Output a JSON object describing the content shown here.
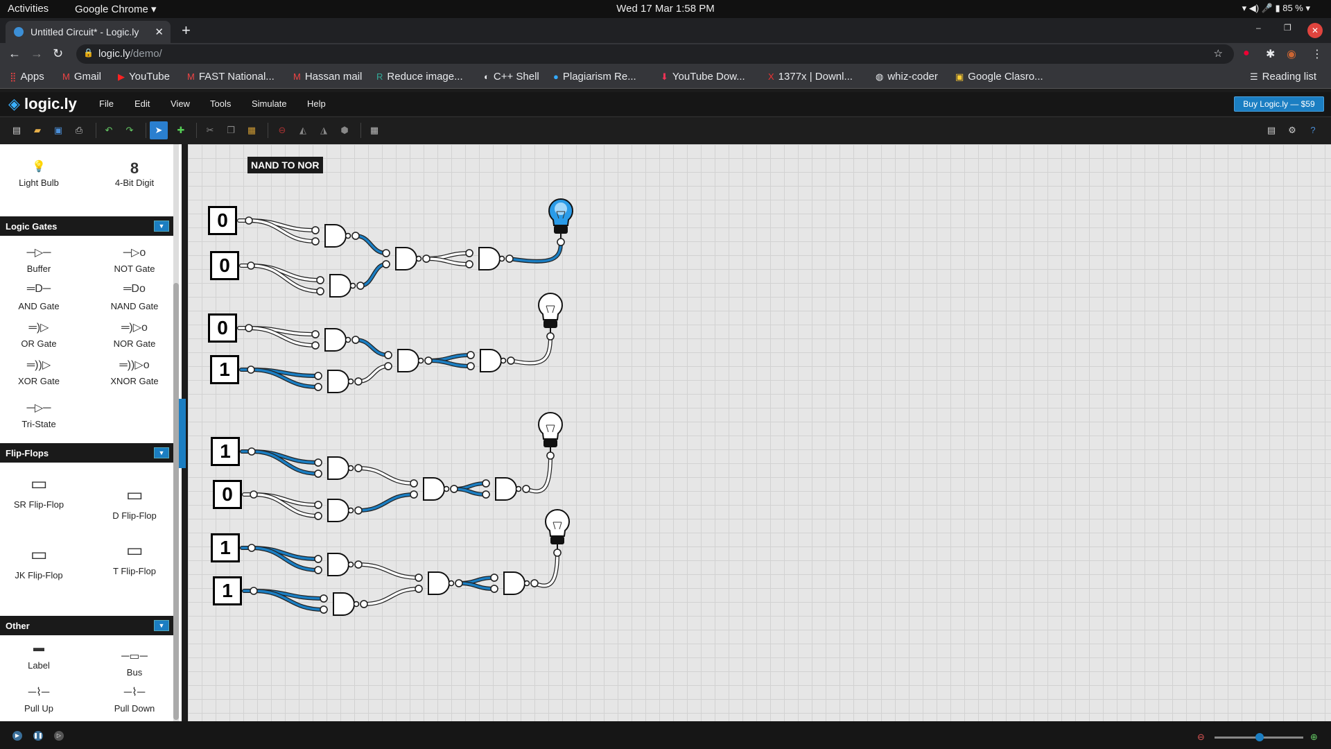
{
  "os_bar": {
    "activities": "Activities",
    "app": "Google Chrome",
    "datetime": "Wed 17 Mar  1:58 PM",
    "battery": "85 %"
  },
  "browser": {
    "tab_title": "Untitled Circuit* - Logic.ly",
    "url_host": "logic.ly",
    "url_path": "/demo/",
    "bookmarks": [
      "Apps",
      "Gmail",
      "YouTube",
      "FAST National...",
      "Hassan mail",
      "Reduce image...",
      "C++ Shell",
      "Plagiarism Re...",
      "YouTube Dow...",
      "1377x | Downl...",
      "whiz-coder",
      "Google Clasro..."
    ],
    "reading_list": "Reading list"
  },
  "app": {
    "logo": "logic.ly",
    "menu": [
      "File",
      "Edit",
      "View",
      "Tools",
      "Simulate",
      "Help"
    ],
    "buy_button": "Buy Logic.ly — $59"
  },
  "sidebar": {
    "outputs": [
      {
        "label": "Light Bulb",
        "icon": "light-bulb-icon"
      },
      {
        "label": "4-Bit Digit",
        "icon": "digit-display-icon"
      }
    ],
    "categories": {
      "logic_gates": {
        "title": "Logic Gates",
        "items": [
          "Buffer",
          "NOT Gate",
          "AND Gate",
          "NAND Gate",
          "OR Gate",
          "NOR Gate",
          "XOR Gate",
          "XNOR Gate",
          "Tri-State"
        ]
      },
      "flip_flops": {
        "title": "Flip-Flops",
        "items": [
          "SR Flip-Flop",
          "D Flip-Flop",
          "JK Flip-Flop",
          "T Flip-Flop"
        ]
      },
      "other": {
        "title": "Other",
        "items": [
          "Label",
          "Bus",
          "Pull Up",
          "Pull Down"
        ]
      }
    }
  },
  "canvas": {
    "label": "NAND TO NOR",
    "circuits": [
      {
        "inputs": [
          "0",
          "0"
        ],
        "output_on": true
      },
      {
        "inputs": [
          "0",
          "1"
        ],
        "output_on": false
      },
      {
        "inputs": [
          "1",
          "0"
        ],
        "output_on": false
      },
      {
        "inputs": [
          "1",
          "1"
        ],
        "output_on": false
      }
    ]
  },
  "colors": {
    "wire_on": "#1b7ec2",
    "wire_off": "#ffffff",
    "accent": "#1b7ec2",
    "bulb_on": "#2a9be8"
  }
}
